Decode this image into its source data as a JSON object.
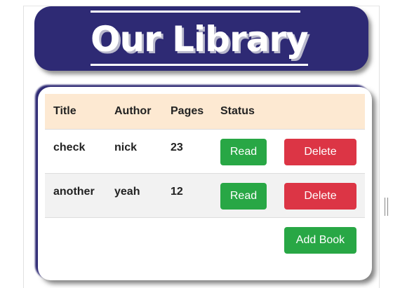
{
  "header": {
    "title": "Our Library"
  },
  "table": {
    "columns": [
      "Title",
      "Author",
      "Pages",
      "Status"
    ],
    "rows": [
      {
        "title": "check",
        "author": "nick",
        "pages": "23",
        "status_label": "Read",
        "delete_label": "Delete"
      },
      {
        "title": "another",
        "author": "yeah",
        "pages": "12",
        "status_label": "Read",
        "delete_label": "Delete"
      }
    ]
  },
  "actions": {
    "add_label": "Add Book"
  },
  "colors": {
    "header_bg": "#2e2a74",
    "table_header_bg": "#fde9d2",
    "read_button": "#28a745",
    "delete_button": "#dc3545",
    "add_button": "#28a745"
  }
}
